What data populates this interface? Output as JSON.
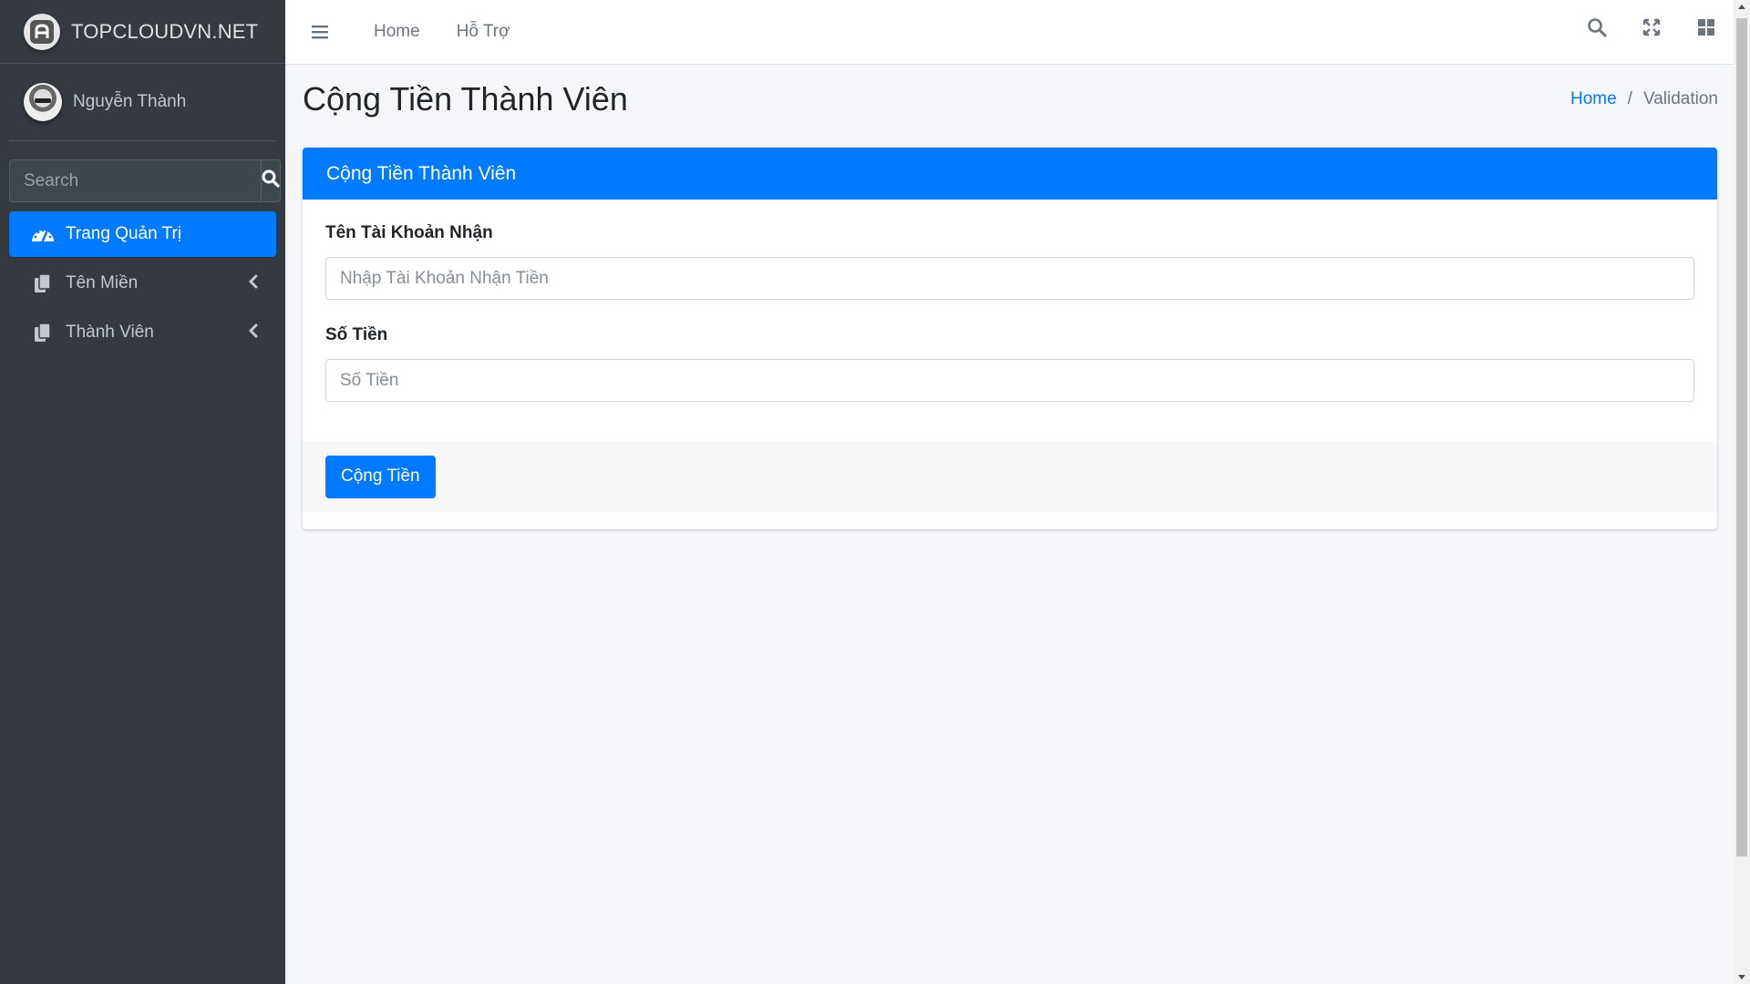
{
  "brand": {
    "name": "TOPCLOUDVN.NET",
    "logo_icon": "logo-icon"
  },
  "user": {
    "name": "Nguyễn Thành"
  },
  "sidebar": {
    "search_placeholder": "Search",
    "items": [
      {
        "label": "Trang Quản Trị",
        "icon": "dashboard-gauge-icon",
        "active": true
      },
      {
        "label": "Tên Miền",
        "icon": "copy-icon",
        "chevron": "chevron-left-icon"
      },
      {
        "label": "Thành Viên",
        "icon": "copy-icon",
        "chevron": "chevron-left-icon"
      }
    ]
  },
  "topbar": {
    "links": [
      "Home",
      "Hỗ Trợ"
    ],
    "icons": [
      "search-icon",
      "expand-icon",
      "grid-icon"
    ]
  },
  "page": {
    "title": "Cộng Tiền Thành Viên",
    "breadcrumb": [
      "Home",
      "Validation"
    ]
  },
  "card": {
    "title": "Cộng Tiền Thành Viên",
    "fields": [
      {
        "label": "Tên Tài Khoản Nhận",
        "placeholder": "Nhập Tài Khoản Nhận Tiền",
        "value": ""
      },
      {
        "label": "Số Tiền",
        "placeholder": "Số Tiền",
        "value": ""
      }
    ],
    "submit_label": "Cộng Tiền"
  },
  "colors": {
    "primary": "#007bff",
    "sidebar_bg": "#343a40",
    "content_bg": "#f4f6f9"
  }
}
